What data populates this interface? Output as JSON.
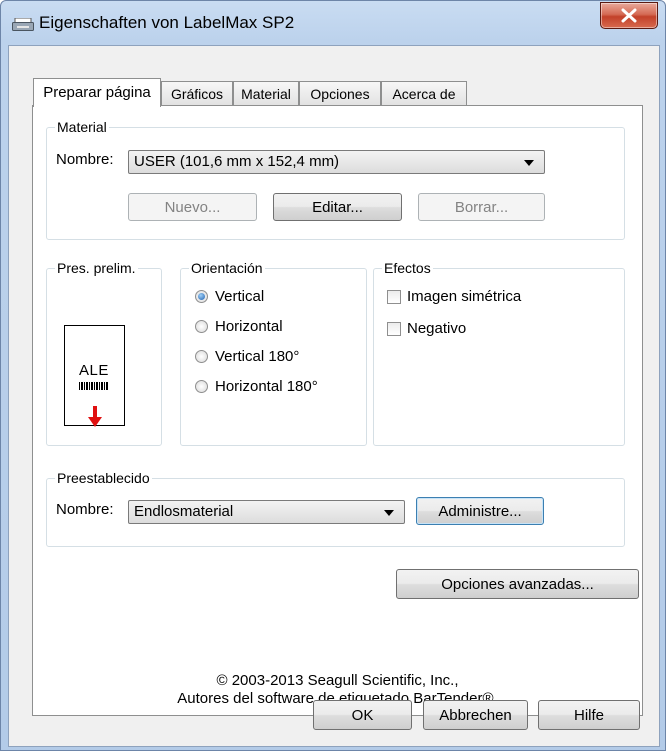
{
  "window": {
    "title": "Eigenschaften von LabelMax SP2"
  },
  "tabs": [
    {
      "label": "Preparar página",
      "active": true
    },
    {
      "label": "Gráficos",
      "active": false
    },
    {
      "label": "Material",
      "active": false
    },
    {
      "label": "Opciones",
      "active": false
    },
    {
      "label": "Acerca de",
      "active": false
    }
  ],
  "material": {
    "group_label": "Material",
    "name_label": "Nombre:",
    "selected": "USER (101,6 mm x 152,4 mm)",
    "buttons": {
      "new": "Nuevo...",
      "edit": "Editar...",
      "delete": "Borrar..."
    }
  },
  "preview": {
    "group_label": "Pres. prelim.",
    "sample_text": "ALE"
  },
  "orientation": {
    "group_label": "Orientación",
    "options": [
      "Vertical",
      "Horizontal",
      "Vertical 180°",
      "Horizontal 180°"
    ],
    "selected": "Vertical"
  },
  "effects": {
    "group_label": "Efectos",
    "mirror": "Imagen simétrica",
    "negative": "Negativo"
  },
  "preset": {
    "group_label": "Preestablecido",
    "name_label": "Nombre:",
    "selected": "Endlosmaterial",
    "manage_button": "Administre..."
  },
  "advanced_button": "Opciones avanzadas...",
  "copyright": {
    "line1": "© 2003-2013 Seagull Scientific, Inc.,",
    "line2": "Autores del software de etiquetado BarTender®."
  },
  "dialog_buttons": {
    "ok": "OK",
    "cancel": "Abbrechen",
    "help": "Hilfe"
  },
  "colors": {
    "accent": "#1f5fae",
    "arrow": "#e01010",
    "close": "#c2412a"
  }
}
